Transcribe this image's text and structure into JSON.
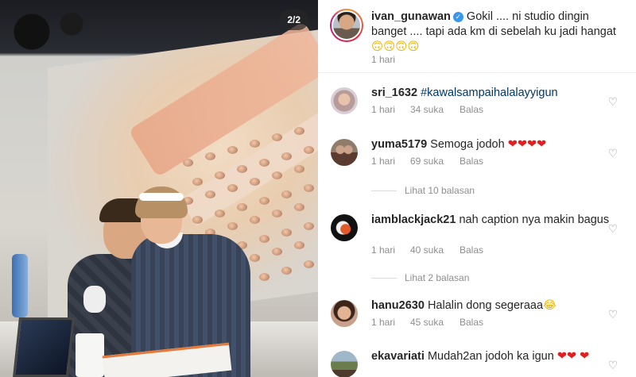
{
  "post": {
    "image_counter": "2/2"
  },
  "caption": {
    "username": "ivan_gunawan",
    "text": "Gokil .... ni studio  dingin banget .... tapi  ada km di  sebelah ku  jadi hangat",
    "emoji": "🙃🙃🙃🙃",
    "time": "1 hari"
  },
  "comments": [
    {
      "username": "sri_1632",
      "text": "#kawalsampaihalalayyigun",
      "time": "1 hari",
      "likes": "34 suka",
      "reply": "Balas"
    },
    {
      "username": "yuma5179",
      "text": "Semoga jodoh",
      "emoji": "❤❤❤❤",
      "time": "1 hari",
      "likes": "69 suka",
      "reply": "Balas",
      "view_replies": "Lihat 10 balasan"
    },
    {
      "username": "iamblackjack21",
      "text": "nah caption nya makin bagus",
      "time": "1 hari",
      "likes": "40 suka",
      "reply": "Balas",
      "view_replies": "Lihat 2 balasan"
    },
    {
      "username": "hanu2630",
      "text": "Halalin dong segeraaa",
      "emoji": "😂",
      "time": "1 hari",
      "likes": "45 suka",
      "reply": "Balas"
    },
    {
      "username": "ekavariati",
      "text": "Mudah2an jodoh ka igun",
      "emoji": "❤❤",
      "emoji2": "❤"
    }
  ],
  "icons": {
    "heart": "heart-outline-icon",
    "verified": "verified-badge-icon"
  },
  "colors": {
    "hashtag": "#00376b",
    "meta_text": "#8e8e8e",
    "verified": "#3897f0"
  }
}
